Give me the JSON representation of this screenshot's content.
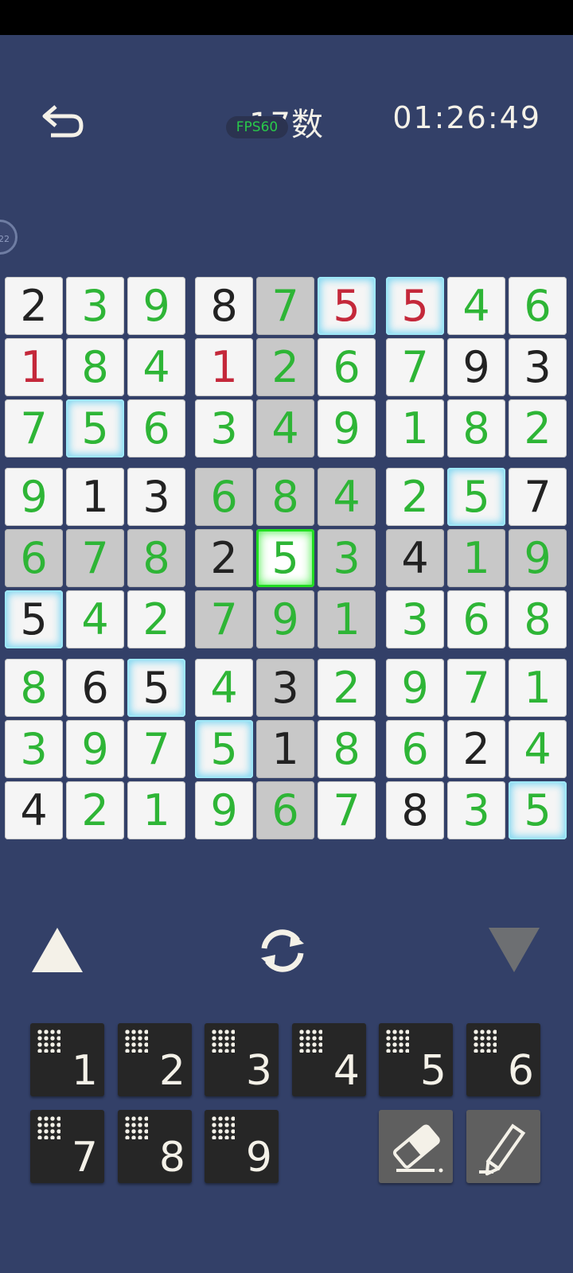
{
  "header": {
    "title": "17数",
    "fps_badge": "FPS60",
    "timer": "01:26:49",
    "side_badge": "22"
  },
  "board": {
    "cells": [
      [
        {
          "v": "2",
          "c": "black"
        },
        {
          "v": "3",
          "c": "green"
        },
        {
          "v": "9",
          "c": "green"
        },
        {
          "v": "8",
          "c": "black"
        },
        {
          "v": "7",
          "c": "green",
          "bg": "gray"
        },
        {
          "v": "5",
          "c": "red",
          "glow": true
        },
        {
          "v": "5",
          "c": "red",
          "glow": true
        },
        {
          "v": "4",
          "c": "green"
        },
        {
          "v": "6",
          "c": "green"
        }
      ],
      [
        {
          "v": "1",
          "c": "red"
        },
        {
          "v": "8",
          "c": "green"
        },
        {
          "v": "4",
          "c": "green"
        },
        {
          "v": "1",
          "c": "red"
        },
        {
          "v": "2",
          "c": "green",
          "bg": "gray"
        },
        {
          "v": "6",
          "c": "green"
        },
        {
          "v": "7",
          "c": "green"
        },
        {
          "v": "9",
          "c": "black"
        },
        {
          "v": "3",
          "c": "black"
        }
      ],
      [
        {
          "v": "7",
          "c": "green"
        },
        {
          "v": "5",
          "c": "green",
          "glow": true
        },
        {
          "v": "6",
          "c": "green"
        },
        {
          "v": "3",
          "c": "green"
        },
        {
          "v": "4",
          "c": "green",
          "bg": "gray"
        },
        {
          "v": "9",
          "c": "green"
        },
        {
          "v": "1",
          "c": "green"
        },
        {
          "v": "8",
          "c": "green"
        },
        {
          "v": "2",
          "c": "green"
        }
      ],
      [
        {
          "v": "9",
          "c": "green"
        },
        {
          "v": "1",
          "c": "black"
        },
        {
          "v": "3",
          "c": "black"
        },
        {
          "v": "6",
          "c": "green",
          "bg": "gray"
        },
        {
          "v": "8",
          "c": "green",
          "bg": "gray"
        },
        {
          "v": "4",
          "c": "green",
          "bg": "gray"
        },
        {
          "v": "2",
          "c": "green"
        },
        {
          "v": "5",
          "c": "green",
          "glow": true
        },
        {
          "v": "7",
          "c": "black"
        }
      ],
      [
        {
          "v": "6",
          "c": "green",
          "bg": "gray"
        },
        {
          "v": "7",
          "c": "green",
          "bg": "gray"
        },
        {
          "v": "8",
          "c": "green",
          "bg": "gray"
        },
        {
          "v": "2",
          "c": "black",
          "bg": "gray"
        },
        {
          "v": "5",
          "c": "green",
          "sel": true
        },
        {
          "v": "3",
          "c": "green",
          "bg": "gray"
        },
        {
          "v": "4",
          "c": "black",
          "bg": "gray"
        },
        {
          "v": "1",
          "c": "green",
          "bg": "gray"
        },
        {
          "v": "9",
          "c": "green",
          "bg": "gray"
        }
      ],
      [
        {
          "v": "5",
          "c": "black",
          "glow": true
        },
        {
          "v": "4",
          "c": "green"
        },
        {
          "v": "2",
          "c": "green"
        },
        {
          "v": "7",
          "c": "green",
          "bg": "gray"
        },
        {
          "v": "9",
          "c": "green",
          "bg": "gray"
        },
        {
          "v": "1",
          "c": "green",
          "bg": "gray"
        },
        {
          "v": "3",
          "c": "green"
        },
        {
          "v": "6",
          "c": "green"
        },
        {
          "v": "8",
          "c": "green"
        }
      ],
      [
        {
          "v": "8",
          "c": "green"
        },
        {
          "v": "6",
          "c": "black"
        },
        {
          "v": "5",
          "c": "black",
          "glow": true
        },
        {
          "v": "4",
          "c": "green"
        },
        {
          "v": "3",
          "c": "black",
          "bg": "gray"
        },
        {
          "v": "2",
          "c": "green"
        },
        {
          "v": "9",
          "c": "green"
        },
        {
          "v": "7",
          "c": "green"
        },
        {
          "v": "1",
          "c": "green"
        }
      ],
      [
        {
          "v": "3",
          "c": "green"
        },
        {
          "v": "9",
          "c": "green"
        },
        {
          "v": "7",
          "c": "green"
        },
        {
          "v": "5",
          "c": "green",
          "glow": true
        },
        {
          "v": "1",
          "c": "black",
          "bg": "gray"
        },
        {
          "v": "8",
          "c": "green"
        },
        {
          "v": "6",
          "c": "green"
        },
        {
          "v": "2",
          "c": "black"
        },
        {
          "v": "4",
          "c": "green"
        }
      ],
      [
        {
          "v": "4",
          "c": "black"
        },
        {
          "v": "2",
          "c": "green"
        },
        {
          "v": "1",
          "c": "green"
        },
        {
          "v": "9",
          "c": "green"
        },
        {
          "v": "6",
          "c": "green",
          "bg": "gray"
        },
        {
          "v": "7",
          "c": "green"
        },
        {
          "v": "8",
          "c": "black"
        },
        {
          "v": "3",
          "c": "green"
        },
        {
          "v": "5",
          "c": "green",
          "glow": true
        }
      ]
    ]
  },
  "keypad": {
    "numbers": [
      "1",
      "2",
      "3",
      "4",
      "5",
      "6",
      "7",
      "8",
      "9"
    ]
  },
  "icons": {
    "back": "back-arrow-icon",
    "refresh": "refresh-icon",
    "up": "triangle-up-icon",
    "down": "triangle-down-icon",
    "eraser": "eraser-icon",
    "pencil": "pencil-icon"
  },
  "colors": {
    "background": "#334068",
    "green_digit": "#2eb536",
    "red_digit": "#c4283a",
    "selected_glow": "#22dd22",
    "highlight_glow": "#7fd7f2"
  }
}
